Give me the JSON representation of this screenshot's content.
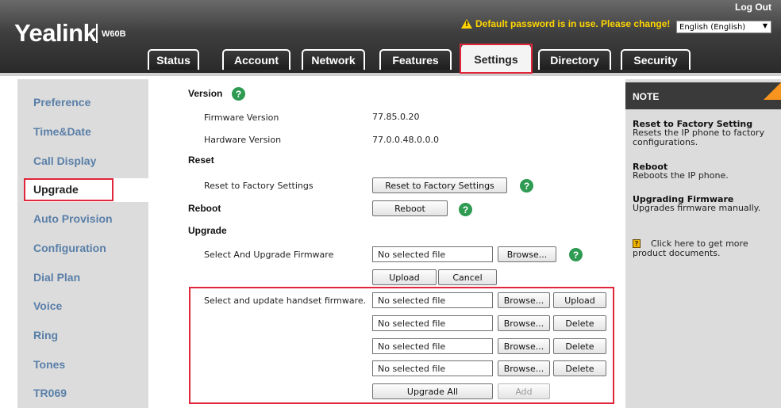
{
  "header": {
    "logo": "Yealink",
    "model": "W60B",
    "logout": "Log Out",
    "warning": "Default password is in use. Please change!",
    "language": "English (English)",
    "tabs": [
      "Status",
      "Account",
      "Network",
      "Features",
      "Settings",
      "Directory",
      "Security"
    ],
    "active_tab": "Settings"
  },
  "sidebar": {
    "items": [
      "Preference",
      "Time&Date",
      "Call Display",
      "Upgrade",
      "Auto Provision",
      "Configuration",
      "Dial Plan",
      "Voice",
      "Ring",
      "Tones",
      "TR069"
    ],
    "active": "Upgrade"
  },
  "content": {
    "version": {
      "title": "Version",
      "firmware_label": "Firmware Version",
      "firmware_value": "77.85.0.20",
      "hardware_label": "Hardware Version",
      "hardware_value": "77.0.0.48.0.0.0"
    },
    "reset": {
      "title": "Reset",
      "label": "Reset to Factory Settings",
      "button": "Reset to Factory Settings"
    },
    "reboot": {
      "title": "Reboot",
      "button": "Reboot"
    },
    "upgrade": {
      "title": "Upgrade",
      "label": "Select And Upgrade Firmware",
      "file_placeholder": "No selected file",
      "browse": "Browse...",
      "upload": "Upload",
      "cancel": "Cancel"
    },
    "handset": {
      "label": "Select and update handset firmware.",
      "rows": [
        {
          "file": "No selected file",
          "browse": "Browse...",
          "action": "Upload"
        },
        {
          "file": "No selected file",
          "browse": "Browse...",
          "action": "Delete"
        },
        {
          "file": "No selected file",
          "browse": "Browse...",
          "action": "Delete"
        },
        {
          "file": "No selected file",
          "browse": "Browse...",
          "action": "Delete"
        }
      ],
      "upgrade_all": "Upgrade All",
      "add": "Add"
    }
  },
  "note": {
    "title": "NOTE",
    "sections": [
      {
        "heading": "Reset to Factory Setting",
        "text": [
          "Resets the IP phone to factory",
          "configurations."
        ]
      },
      {
        "heading": "Reboot",
        "text": [
          "Reboots the IP phone."
        ]
      },
      {
        "heading": "Upgrading Firmware",
        "text": [
          "Upgrades firmware manually."
        ]
      }
    ],
    "docs_link": [
      "Click here to get more",
      "product documents."
    ]
  },
  "colors": {
    "highlight_red": "#e0263a",
    "sidebar_text": "#5a7fa8",
    "warning_yellow": "#ffd500",
    "help_green": "#2e9a52",
    "note_corner": "#f7941d"
  },
  "icons": {
    "warning": "warning-triangle-icon",
    "help": "question-circle-icon",
    "docs": "document-icon",
    "dropdown": "dropdown-arrow-icon"
  }
}
